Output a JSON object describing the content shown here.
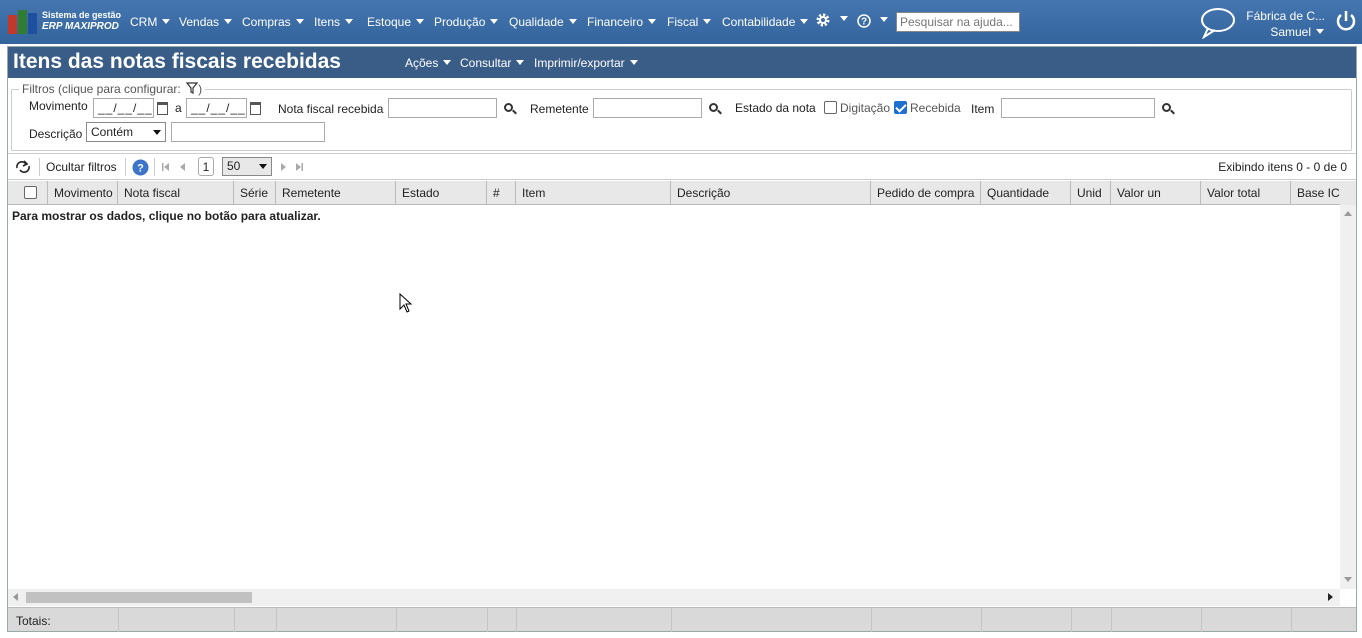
{
  "app": {
    "logo_line1": "Sistema de gestão",
    "logo_line2": "ERP MAXIPROD",
    "menu": [
      "CRM",
      "Vendas",
      "Compras",
      "Itens",
      "Estoque",
      "Produção",
      "Qualidade",
      "Financeiro",
      "Fiscal",
      "Contabilidade"
    ],
    "search_placeholder": "Pesquisar na ajuda...",
    "company": "Fábrica de C...",
    "user": "Samuel"
  },
  "page": {
    "title": "Itens das notas fiscais recebidas",
    "menus": [
      "Ações",
      "Consultar",
      "Imprimir/exportar"
    ]
  },
  "filters": {
    "legend": "Filtros (clique para configurar:",
    "legend_close": ")",
    "movimento_label": "Movimento",
    "date_from": "__/__/__",
    "date_sep": "a",
    "date_to": "__/__/__",
    "nf_label": "Nota fiscal recebida",
    "remetente_label": "Remetente",
    "estado_label": "Estado da nota",
    "digitacao_label": "Digitação",
    "digitacao_checked": false,
    "recebida_label": "Recebida",
    "recebida_checked": true,
    "item_label": "Item",
    "descricao_label": "Descrição",
    "descricao_op": "Contém"
  },
  "toolbar": {
    "hide_filters": "Ocultar filtros",
    "page_number": "1",
    "page_size": "50",
    "display_info": "Exibindo itens 0 - 0 de 0"
  },
  "grid": {
    "columns": [
      "Movimento",
      "Nota fiscal",
      "Série",
      "Remetente",
      "Estado",
      "#",
      "Item",
      "Descrição",
      "Pedido de compra",
      "Quantidade",
      "Unid",
      "Valor un",
      "Valor total",
      "Base IC"
    ],
    "empty_message": "Para mostrar os dados, clique no botão para atualizar.",
    "totals_label": "Totais:"
  },
  "colors": {
    "topbar": "#3d6fa8",
    "titlebar": "#3a5d87",
    "accent_check": "#1e6fd0"
  }
}
